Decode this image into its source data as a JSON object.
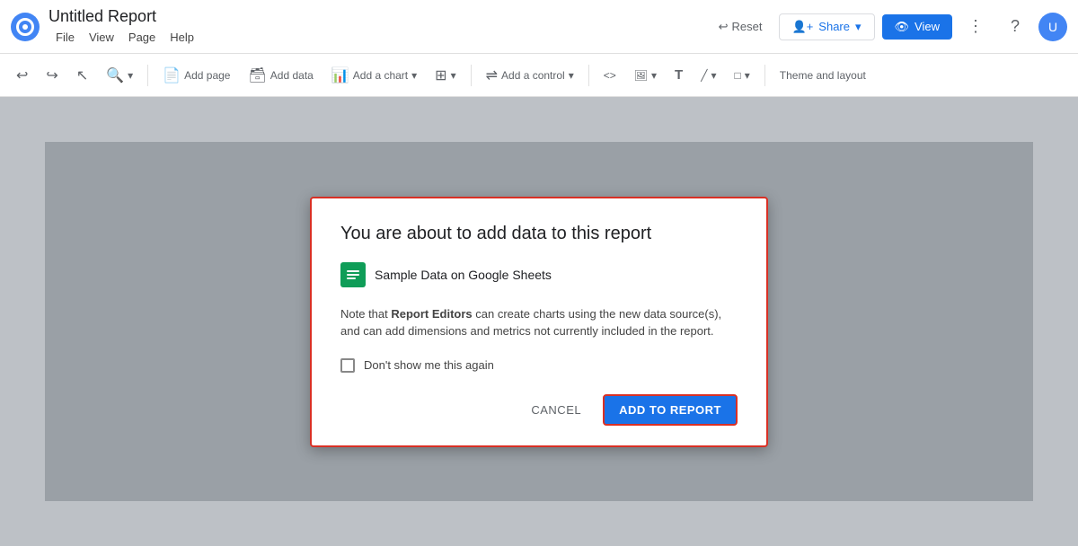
{
  "app": {
    "logo_label": "Looker Studio",
    "title": "Untitled Report",
    "menu": [
      "File",
      "View",
      "Page",
      "Help"
    ]
  },
  "topbar": {
    "reset_label": "Reset",
    "share_label": "Share",
    "view_label": "View",
    "more_icon": "⋮",
    "help_icon": "?",
    "avatar_label": "U"
  },
  "toolbar": {
    "undo_icon": "↩",
    "redo_icon": "↪",
    "select_icon": "↖",
    "zoom_label": "",
    "add_page_label": "Add page",
    "add_data_label": "Add data",
    "add_chart_label": "Add a chart",
    "components_label": "",
    "add_control_label": "Add a control",
    "code_icon": "<>",
    "image_icon": "🖼",
    "text_icon": "T",
    "line_icon": "╱",
    "shape_icon": "□",
    "theme_label": "Theme and layout"
  },
  "dialog": {
    "title": "You are about to add data to this report",
    "data_source_name": "Sample Data on Google Sheets",
    "note_text_prefix": "Note that ",
    "note_text_bold": "Report Editors",
    "note_text_suffix": " can create charts using the new data source(s), and can add dimensions and metrics not currently included in the report.",
    "checkbox_label": "Don't show me this again",
    "cancel_label": "CANCEL",
    "add_to_report_label": "ADD TO REPORT"
  }
}
